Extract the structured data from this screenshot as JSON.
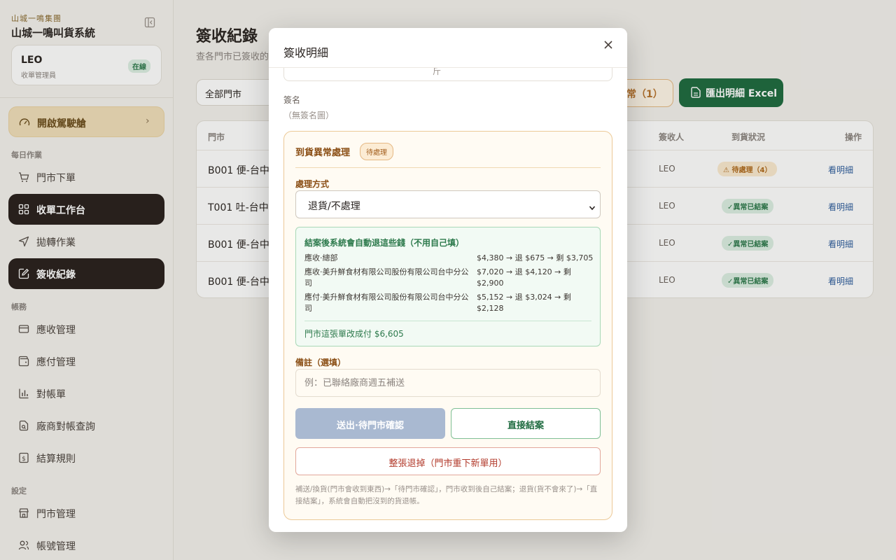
{
  "sidebar": {
    "brand_sub": "山城一鳴集團",
    "brand_title": "山城一鳴叫貨系統",
    "user": {
      "name": "LEO",
      "role": "收單管理員",
      "status": "在線"
    },
    "drive_button": "開啟駕駛艙",
    "section_daily": "每日作業",
    "section_accounts": "帳務",
    "section_settings": "設定",
    "items": [
      {
        "label": "門市下單",
        "icon": "cart-icon"
      },
      {
        "label": "收單工作台",
        "icon": "grid-icon",
        "active": true
      },
      {
        "label": "拋轉作業",
        "icon": "send-icon"
      },
      {
        "label": "簽收紀錄",
        "icon": "edit-doc-icon",
        "active": true
      },
      {
        "label": "應收管理",
        "icon": "card-icon"
      },
      {
        "label": "應付管理",
        "icon": "wallet-icon"
      },
      {
        "label": "對帳單",
        "icon": "bar-chart-icon"
      },
      {
        "label": "廠商對帳查詢",
        "icon": "file-search-icon"
      },
      {
        "label": "結算規則",
        "icon": "dollar-doc-icon"
      },
      {
        "label": "門市管理",
        "icon": "store-icon"
      },
      {
        "label": "帳號管理",
        "icon": "users-icon"
      }
    ]
  },
  "main": {
    "title": "簽收紀錄",
    "subtitle": "查各門市已簽收的",
    "store_filter": "全部門市",
    "abnormal_button": "常（1）",
    "export_button": "匯出明細 Excel",
    "columns": {
      "store": "門市",
      "signer": "簽收人",
      "status": "到貨狀況",
      "action": "操作"
    },
    "rows": [
      {
        "store": "B001 便-台中域",
        "signer": "LEO",
        "status": "待處理（4）",
        "action": "看明細"
      },
      {
        "store": "T001 吐-台中4",
        "signer": "LEO",
        "status": "✓異常已結案",
        "action": "看明細"
      },
      {
        "store": "B001 便-台中域",
        "signer": "LEO",
        "status": "✓異常已結案",
        "action": "看明細"
      },
      {
        "store": "B001 便-台中域",
        "signer": "LEO",
        "status": "✓異常已結案",
        "action": "看明細"
      }
    ]
  },
  "modal": {
    "title": "簽收明細",
    "clipped_text": "斤",
    "sign_label": "簽名",
    "sign_value": "（無簽名圖）",
    "abnormal": {
      "title": "到貨異常處理",
      "badge": "待處理",
      "method_label": "處理方式",
      "method_value": "退貨/不處理",
      "auto_title": "結案後系統會自動退這些錢（不用自己填）",
      "lines": [
        {
          "label": "應收·總部",
          "value": "$4,380 → 退 $675 → 剩 $3,705"
        },
        {
          "label": "應收·美升鮮食材有限公司股份有限公司台中分公司",
          "value": "$7,020 → 退 $4,120 → 剩 $2,900"
        },
        {
          "label": "應付·美升鮮食材有限公司股份有限公司台中分公司",
          "value": "$5,152 → 退 $3,024 → 剩 $2,128"
        }
      ],
      "total": "門市這張單改成付 $6,605",
      "note_label": "備註（選填）",
      "note_placeholder": "例：已聯絡廠商週五補送",
      "btn_send": "送出·待門市確認",
      "btn_close": "直接結案",
      "btn_reject": "整張退掉（門市重下新單用）",
      "help": "補送/換貨(門市會收到東西)→「待門市確認」，門市收到後自己結案；退貨(貨不會來了)→「直接結案」，系統會自動把沒到的貨退帳。"
    }
  }
}
